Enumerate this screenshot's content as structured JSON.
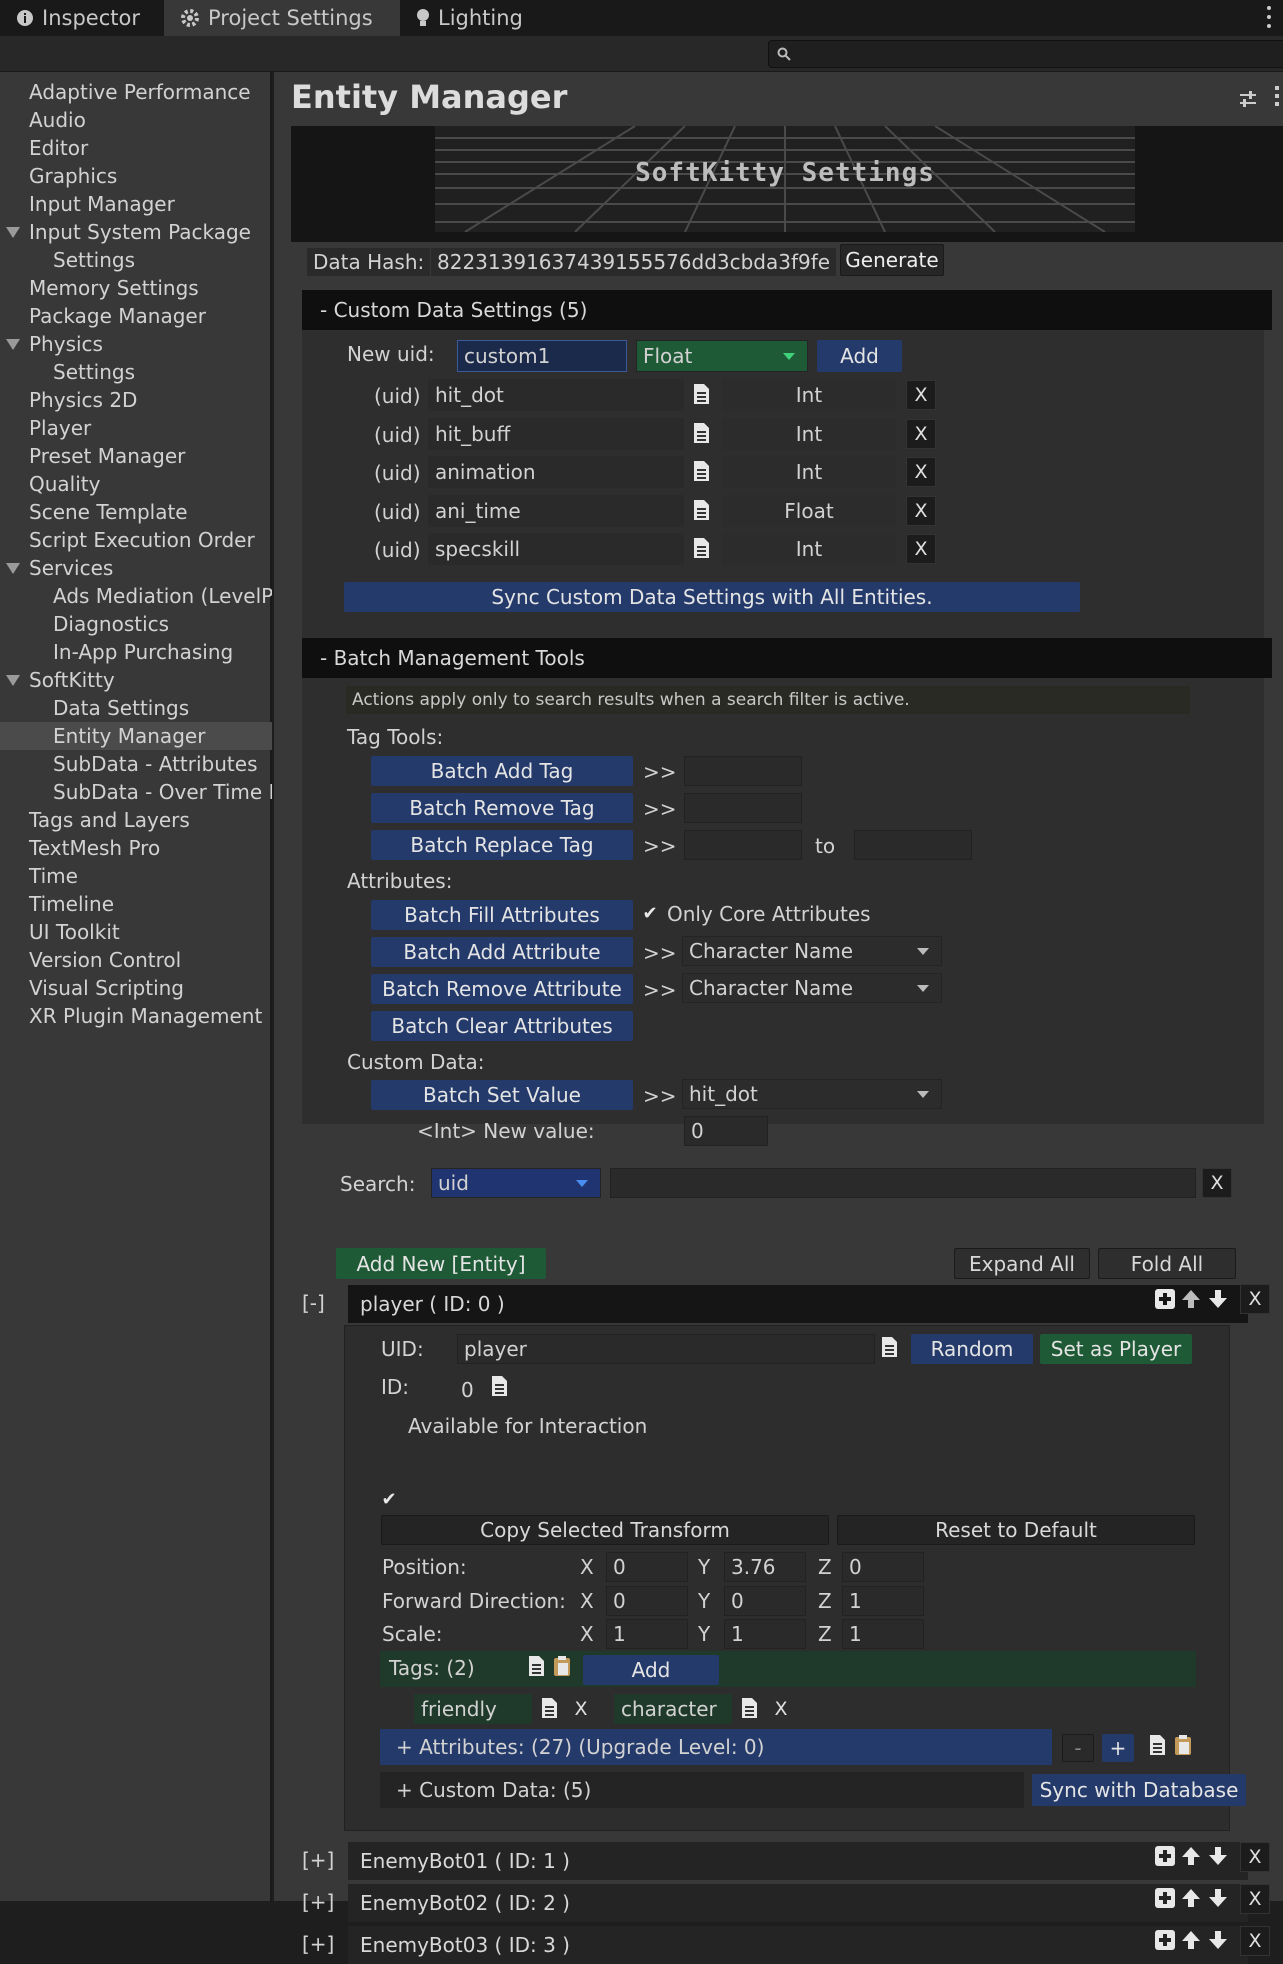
{
  "tabs": [
    {
      "label": "Inspector",
      "icon": "info-icon"
    },
    {
      "label": "Project Settings",
      "icon": "gear-icon"
    },
    {
      "label": "Lighting",
      "icon": "lightbulb-icon"
    }
  ],
  "sidebar": {
    "items": [
      "Adaptive Performance",
      "Audio",
      "Editor",
      "Graphics",
      "Input Manager",
      "Input System Package",
      "Settings",
      "Memory Settings",
      "Package Manager",
      "Physics",
      "Settings",
      "Physics 2D",
      "Player",
      "Preset Manager",
      "Quality",
      "Scene Template",
      "Script Execution Order",
      "Services",
      "Ads Mediation (LevelP",
      "Diagnostics",
      "In-App Purchasing",
      "SoftKitty",
      "Data Settings",
      "Entity Manager",
      "SubData - Attributes",
      "SubData - Over Time I",
      "Tags and Layers",
      "TextMesh Pro",
      "Time",
      "Timeline",
      "UI Toolkit",
      "Version Control",
      "Visual Scripting",
      "XR Plugin Management"
    ],
    "selected": "Entity Manager"
  },
  "page": {
    "title": "Entity Manager",
    "banner_text": "SoftKitty Settings"
  },
  "hash": {
    "label": "Data Hash:",
    "value": "8223139163743​9155576dd3cbda3f9fe",
    "button": "Generate"
  },
  "custom_data": {
    "header": "- Custom Data Settings (5)",
    "new_uid_label": "New uid:",
    "new_uid_value": "custom1",
    "type_value": "Float",
    "add_label": "Add",
    "uid_tag": "(uid)",
    "rows": [
      {
        "uid": "hit_dot",
        "type": "Int"
      },
      {
        "uid": "hit_buff",
        "type": "Int"
      },
      {
        "uid": "animation",
        "type": "Int"
      },
      {
        "uid": "ani_time",
        "type": "Float"
      },
      {
        "uid": "specskill",
        "type": "Int"
      }
    ],
    "remove_label": "X",
    "sync_label": "Sync Custom Data Settings with All Entities."
  },
  "batch": {
    "header": "- Batch Management Tools",
    "notice": "Actions apply only to search results when a search filter is active.",
    "tag_tools": "Tag Tools:",
    "add_tag": "Batch Add Tag",
    "remove_tag": "Batch Remove Tag",
    "replace_tag": "Batch Replace Tag",
    "arrow": ">>",
    "to": "to",
    "attributes": "Attributes:",
    "fill_attr": "Batch Fill Attributes",
    "only_core": "Only Core Attributes",
    "add_attr": "Batch Add Attribute",
    "remove_attr": "Batch Remove Attribute",
    "clear_attr": "Batch Clear Attributes",
    "attr_select": "Character Name",
    "custom_data": "Custom Data:",
    "set_value": "Batch Set Value",
    "set_value_select": "hit_dot",
    "new_value_label": "<Int> New value:",
    "new_value": "0"
  },
  "search": {
    "label": "Search:",
    "field": "uid",
    "value": "",
    "clear": "X"
  },
  "list": {
    "add_new": "Add New [Entity]",
    "expand_all": "Expand All",
    "fold_all": "Fold All"
  },
  "player": {
    "toggle": "[-]",
    "title": "player  ( ID: 0 )",
    "uid_label": "UID:",
    "uid": "player",
    "random": "Random",
    "set_player": "Set as Player",
    "id_label": "ID:",
    "id": "0",
    "available": "Available for Interaction",
    "copy_transform": "Copy Selected Transform",
    "reset": "Reset to Default",
    "transform": [
      {
        "label": "Position:",
        "x": "0",
        "y": "3.76",
        "z": "0"
      },
      {
        "label": "Forward Direction:",
        "x": "0",
        "y": "0",
        "z": "1"
      },
      {
        "label": "Scale:",
        "x": "1",
        "y": "1",
        "z": "1"
      }
    ],
    "axis": {
      "x": "X",
      "y": "Y",
      "z": "Z"
    },
    "tags_label": "Tags: (2)",
    "tags_add": "Add",
    "tags": [
      "friendly",
      "character"
    ],
    "attributes": "+ Attributes: (27) (Upgrade Level: 0)",
    "minus": "-",
    "plus": "+",
    "custom_data": "+ Custom Data: (5)",
    "sync_db": "Sync with Database"
  },
  "others": [
    {
      "toggle": "[+]",
      "title": "EnemyBot01  ( ID: 1 )"
    },
    {
      "toggle": "[+]",
      "title": "EnemyBot02  ( ID: 2 )"
    },
    {
      "toggle": "[+]",
      "title": "EnemyBot03  ( ID: 3 )"
    }
  ],
  "colors": {
    "blue_button": "#243a6b",
    "green_button": "#1f5a36",
    "panel": "#2e2e2e",
    "header": "#0f0f0f"
  }
}
